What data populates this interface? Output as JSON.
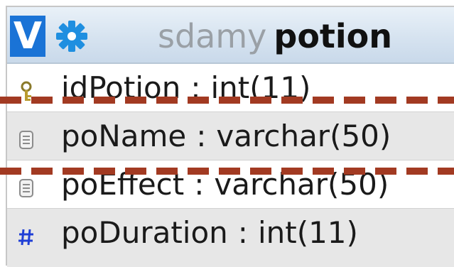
{
  "header": {
    "view_toggle_label": "V",
    "database_name": "sdamy",
    "table_name": "potion"
  },
  "columns": [
    {
      "name": "idPotion",
      "separator": ":",
      "type": "int(11)",
      "icon": "primary-key-icon"
    },
    {
      "name": "poName",
      "separator": ":",
      "type": "varchar(50)",
      "icon": "text-column-icon"
    },
    {
      "name": "poEffect",
      "separator": ":",
      "type": "varchar(50)",
      "icon": "text-column-icon"
    },
    {
      "name": "poDuration",
      "separator": ":",
      "type": "int(11)",
      "icon": "numeric-column-icon"
    }
  ],
  "colors": {
    "accent": "#1a73d6",
    "dash_annotation": "#a23a22",
    "alt_row": "#e7e7e7"
  }
}
